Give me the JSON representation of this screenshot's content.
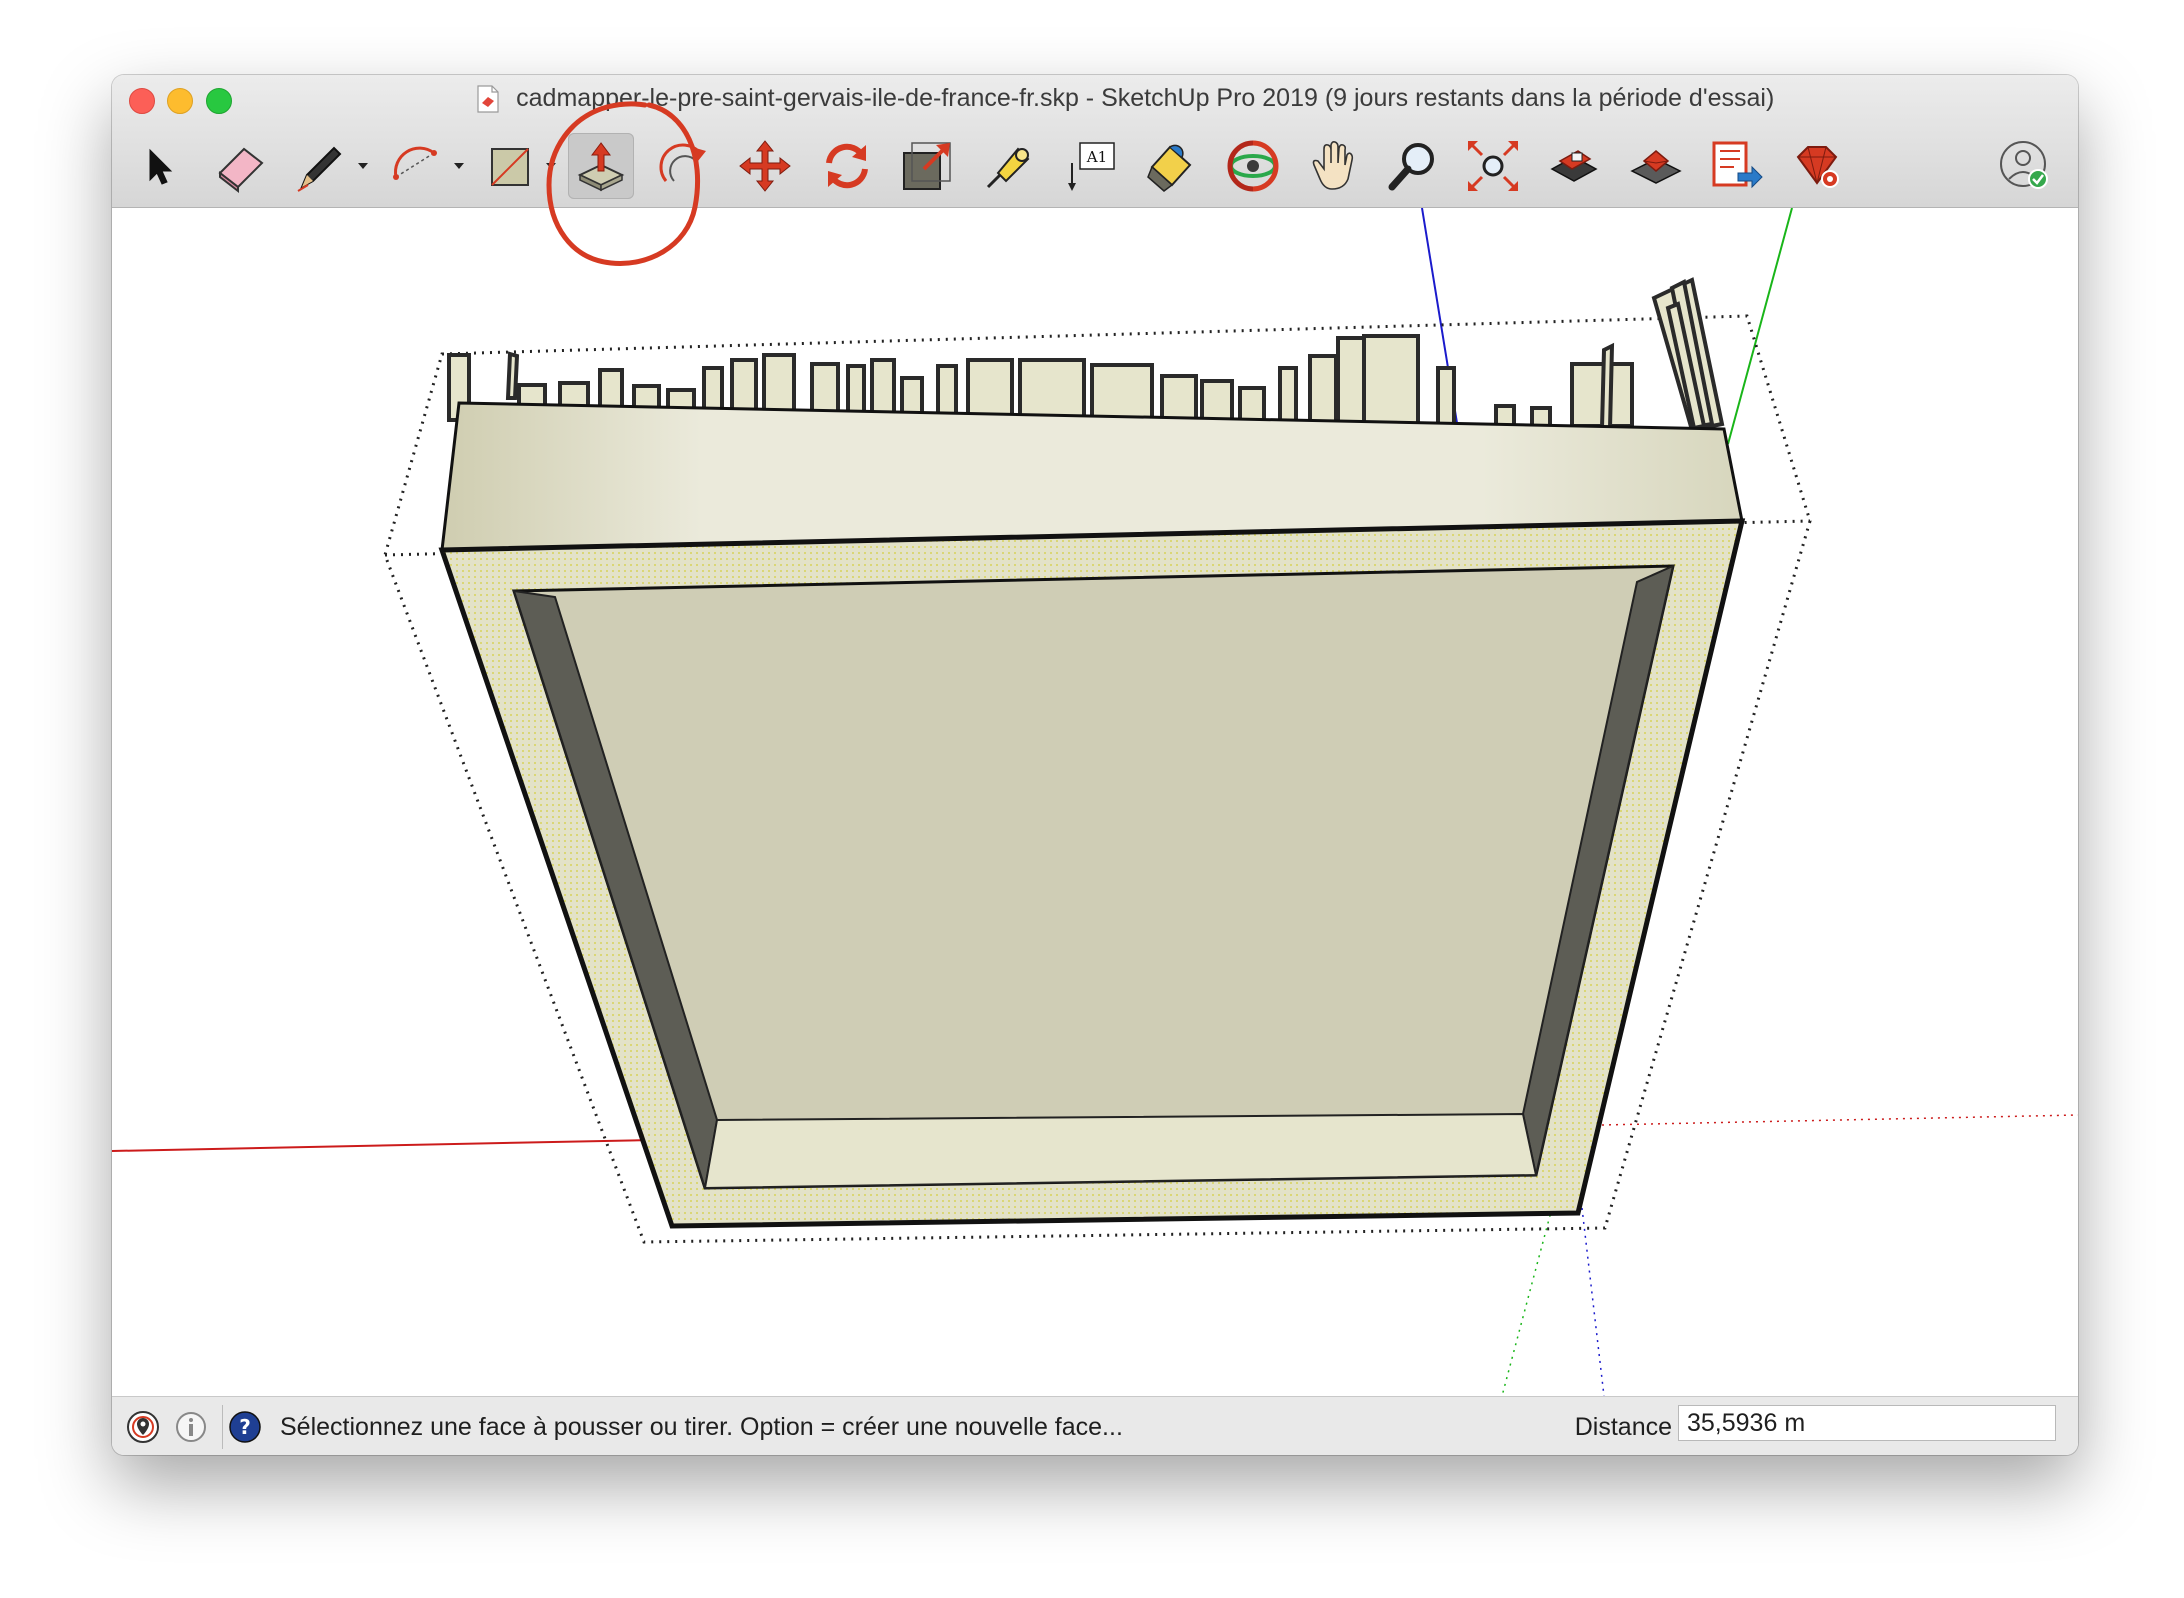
{
  "window": {
    "title": "cadmapper-le-pre-saint-gervais-ile-de-france-fr.skp - SketchUp Pro 2019 (9 jours restants dans la période d'essai)"
  },
  "toolbar": {
    "tools": [
      {
        "name": "select",
        "icon": "arrow-cursor-icon"
      },
      {
        "name": "eraser",
        "icon": "eraser-icon"
      },
      {
        "name": "line",
        "icon": "pencil-icon",
        "has_dropdown": true
      },
      {
        "name": "arc",
        "icon": "arc-icon",
        "has_dropdown": true
      },
      {
        "name": "rectangle",
        "icon": "rectangle-icon",
        "has_dropdown": true
      },
      {
        "name": "push-pull",
        "icon": "push-pull-icon",
        "active": true
      },
      {
        "name": "offset",
        "icon": "offset-icon"
      },
      {
        "name": "move",
        "icon": "move-icon"
      },
      {
        "name": "rotate",
        "icon": "rotate-icon"
      },
      {
        "name": "scale",
        "icon": "scale-icon"
      },
      {
        "name": "tape-measure",
        "icon": "tape-measure-icon"
      },
      {
        "name": "text",
        "icon": "text-icon",
        "label": "A1"
      },
      {
        "name": "paint-bucket",
        "icon": "paint-bucket-icon"
      },
      {
        "name": "orbit",
        "icon": "orbit-icon"
      },
      {
        "name": "pan",
        "icon": "pan-hand-icon"
      },
      {
        "name": "zoom",
        "icon": "zoom-icon"
      },
      {
        "name": "zoom-extents",
        "icon": "zoom-extents-icon"
      },
      {
        "name": "3d-warehouse",
        "icon": "warehouse-icon"
      },
      {
        "name": "extension-warehouse",
        "icon": "extension-warehouse-icon"
      },
      {
        "name": "send-to-layout",
        "icon": "layout-icon"
      },
      {
        "name": "extension-manager",
        "icon": "ruby-gear-icon"
      }
    ],
    "account_icon": "user-account-icon"
  },
  "colors": {
    "annotation": "#d63a22",
    "axis_red": "#cc1b1b",
    "axis_green": "#19b519",
    "axis_blue": "#1b1bcc",
    "model_face": "#e3e2c8",
    "model_inner": "#cfcdb5",
    "model_shadow": "#5d5d55"
  },
  "status": {
    "icons": [
      "geo-location-icon",
      "credits-icon",
      "help-icon"
    ],
    "message": "Sélectionnez une face à pousser ou tirer. Option = créer une nouvelle face...",
    "vcb_label": "Distance",
    "vcb_value": "35,5936 m"
  }
}
